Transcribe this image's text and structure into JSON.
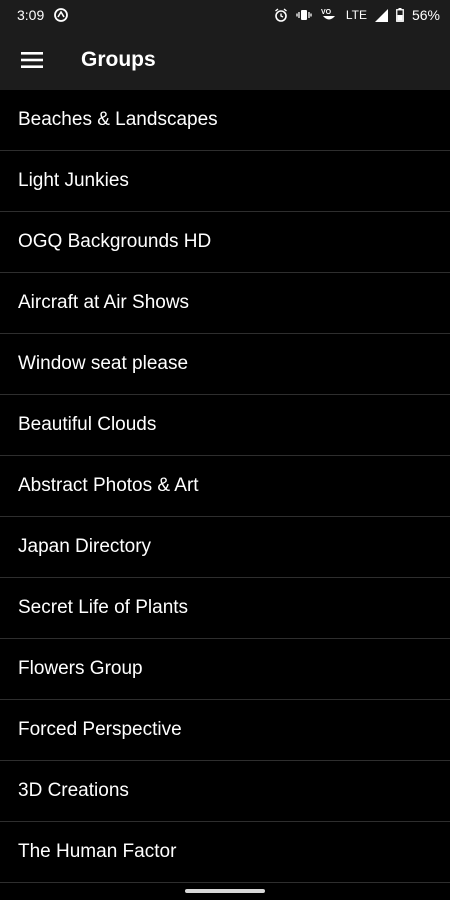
{
  "status_bar": {
    "time": "3:09",
    "network": "LTE",
    "battery": "56%",
    "icons": [
      "notification-icon",
      "alarm-icon",
      "vibrate-icon",
      "volte-icon",
      "signal-icon",
      "battery-icon"
    ]
  },
  "app_bar": {
    "title": "Groups",
    "menu_icon": "menu-icon"
  },
  "groups": [
    "Beaches & Landscapes",
    "Light Junkies",
    "OGQ Backgrounds HD",
    "Aircraft at Air Shows",
    "Window seat please",
    "Beautiful Clouds",
    "Abstract Photos & Art",
    "Japan Directory",
    "Secret Life of Plants",
    "Flowers Group",
    "Forced Perspective",
    "3D Creations",
    "The Human Factor"
  ],
  "colors": {
    "background": "#000000",
    "bar": "#1c1c1c",
    "divider": "#2e2e2e",
    "text": "#ffffff"
  }
}
